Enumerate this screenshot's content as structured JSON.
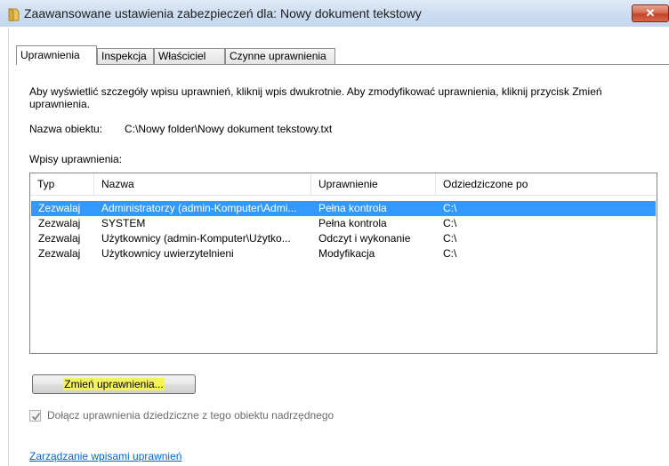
{
  "window": {
    "title": "Zaawansowane ustawienia zabezpieczeń dla: Nowy dokument tekstowy",
    "close_label": "✕"
  },
  "tabs": [
    {
      "label": "Uprawnienia",
      "active": true
    },
    {
      "label": "Inspekcja",
      "active": false
    },
    {
      "label": "Właściciel",
      "active": false
    },
    {
      "label": "Czynne uprawnienia",
      "active": false
    }
  ],
  "description": "Aby wyświetlić szczegóły wpisu uprawnień, kliknij wpis dwukrotnie. Aby zmodyfikować uprawnienia, kliknij przycisk Zmień uprawnienia.",
  "object": {
    "label": "Nazwa obiektu:",
    "value": "C:\\Nowy folder\\Nowy dokument tekstowy.txt"
  },
  "entries_label": "Wpisy uprawnienia:",
  "table": {
    "columns": [
      "Typ",
      "Nazwa",
      "Uprawnienie",
      "Odziedziczone po"
    ],
    "rows": [
      {
        "type": "Zezwalaj",
        "name": "Administratorzy (admin-Komputer\\Admi...",
        "permission": "Pełna kontrola",
        "inherited": "C:\\",
        "selected": true
      },
      {
        "type": "Zezwalaj",
        "name": "SYSTEM",
        "permission": "Pełna kontrola",
        "inherited": "C:\\",
        "selected": false
      },
      {
        "type": "Zezwalaj",
        "name": "Użytkownicy (admin-Komputer\\Użytko...",
        "permission": "Odczyt i wykonanie",
        "inherited": "C:\\",
        "selected": false
      },
      {
        "type": "Zezwalaj",
        "name": "Użytkownicy uwierzytelnieni",
        "permission": "Modyfikacja",
        "inherited": "C:\\",
        "selected": false
      }
    ]
  },
  "change_button_label": "Zmień uprawnienia...",
  "inherit_checkbox": {
    "label": "Dołącz uprawnienia dziedziczne z tego obiektu nadrzędnego",
    "checked": true,
    "disabled": true
  },
  "manage_link": "Zarządzanie wpisami uprawnień",
  "colors": {
    "selection": "#3399ff",
    "highlight": "#f5f55a",
    "link": "#0066cc",
    "close": "#c2462a"
  }
}
